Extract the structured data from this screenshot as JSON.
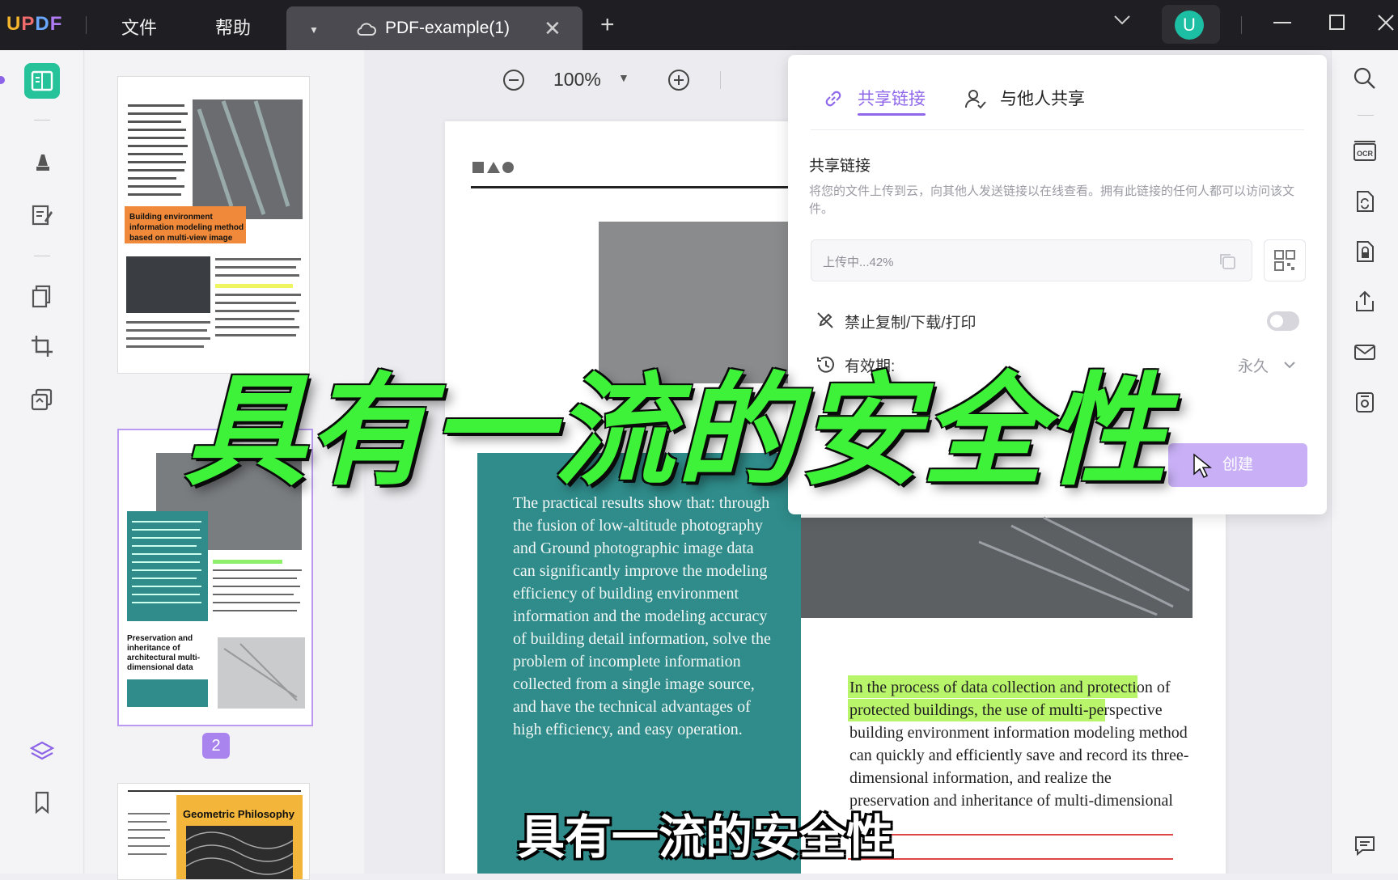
{
  "titlebar": {
    "logo": {
      "u": "U",
      "p": "P",
      "d": "D",
      "f": "F"
    },
    "menu_file": "文件",
    "menu_help": "帮助",
    "tab_name": "PDF-example(1)",
    "avatar_letter": "U"
  },
  "toolbar": {
    "zoom": "100%"
  },
  "thumbnails": {
    "page1_banner": "Building environment information modeling method based on multi-view image",
    "page2_caption": "Preservation and inheritance of architectural multi-dimensional data",
    "page3_title": "Geometric Philosophy",
    "selected_page": "2"
  },
  "document": {
    "teal_paragraph": "The practical results show that: through the fusion of low-altitude photography and Ground photographic image data can significantly improve the modeling efficiency of building environment information and the modeling accuracy of building detail information, solve the problem of incomplete information collected from a single image source, and have the technical advantages of high efficiency, and easy operation.",
    "highlight_1": "In the process of data collection and",
    "highlight_2": "protection of protected buildings,",
    "body_after": " the use of multi-perspective building environment information modeling method can quickly and efficiently save and record its three-dimensional information, and realize the preservation",
    "strike_line": "and inheritance of multi-dimensional"
  },
  "share_panel": {
    "tab_link": "共享链接",
    "tab_others": "与他人共享",
    "section_title": "共享链接",
    "description": "将您的文件上传到云，向其他人发送链接以在线查看。拥有此链接的任何人都可以访问该文件。",
    "upload_status": "上传中...42%",
    "restrict_label": "禁止复制/下载/打印",
    "restrict_enabled": false,
    "validity_label": "有效期:",
    "validity_value": "永久",
    "create_button": "创建"
  },
  "overlay": {
    "headline": "具有一流的安全性",
    "subtitle": "具有一流的安全性"
  },
  "colors": {
    "accent": "#8f67ea",
    "teal": "#2f8c8a",
    "headline_green": "#3ef23a",
    "active_icon": "#26c39a"
  }
}
